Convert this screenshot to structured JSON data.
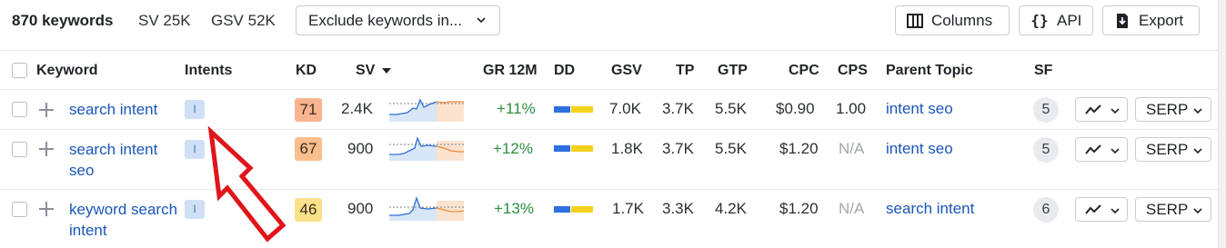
{
  "toolbar": {
    "keyword_count": "870 keywords",
    "sv_total": "SV 25K",
    "gsv_total": "GSV 52K",
    "exclude_label": "Exclude keywords in...",
    "columns_label": "Columns",
    "api_label": "API",
    "export_label": "Export"
  },
  "columns": {
    "keyword": "Keyword",
    "intents": "Intents",
    "kd": "KD",
    "sv": "SV",
    "gr12m": "GR 12M",
    "dd": "DD",
    "gsv": "GSV",
    "tp": "TP",
    "gtp": "GTP",
    "cpc": "CPC",
    "cps": "CPS",
    "parent_topic": "Parent Topic",
    "sf": "SF"
  },
  "rows": [
    {
      "keyword": "search intent",
      "intent": "I",
      "kd": "71",
      "kd_color": "#f9b48f",
      "sv": "2.4K",
      "gr12m": "+11%",
      "gsv": "7.0K",
      "tp": "3.7K",
      "gtp": "5.5K",
      "cpc": "$0.90",
      "cps": "1.00",
      "parent_topic": "intent seo",
      "sf": "5",
      "serp_label": "SERP"
    },
    {
      "keyword": "search intent seo",
      "intent": "I",
      "kd": "67",
      "kd_color": "#f9bd8e",
      "sv": "900",
      "gr12m": "+12%",
      "gsv": "1.8K",
      "tp": "3.7K",
      "gtp": "5.5K",
      "cpc": "$1.20",
      "cps": "N/A",
      "parent_topic": "intent seo",
      "sf": "5",
      "serp_label": "SERP"
    },
    {
      "keyword": "keyword search intent",
      "intent": "I",
      "kd": "46",
      "kd_color": "#fbe18a",
      "sv": "900",
      "gr12m": "+13%",
      "gsv": "1.7K",
      "tp": "3.3K",
      "gtp": "4.2K",
      "cpc": "$1.20",
      "cps": "N/A",
      "parent_topic": "search intent",
      "sf": "6",
      "serp_label": "SERP"
    }
  ],
  "colors": {
    "link": "#1a56b8",
    "growth": "#2a8f3e",
    "dd_blue": "#2e6fe0",
    "dd_yellow": "#f3d21e",
    "annotation_arrow": "#e0151b"
  },
  "icons": [
    "columns-icon",
    "api-braces-icon",
    "export-icon",
    "chevron-down-icon",
    "sort-desc-icon",
    "plus-icon",
    "trend-icon"
  ]
}
